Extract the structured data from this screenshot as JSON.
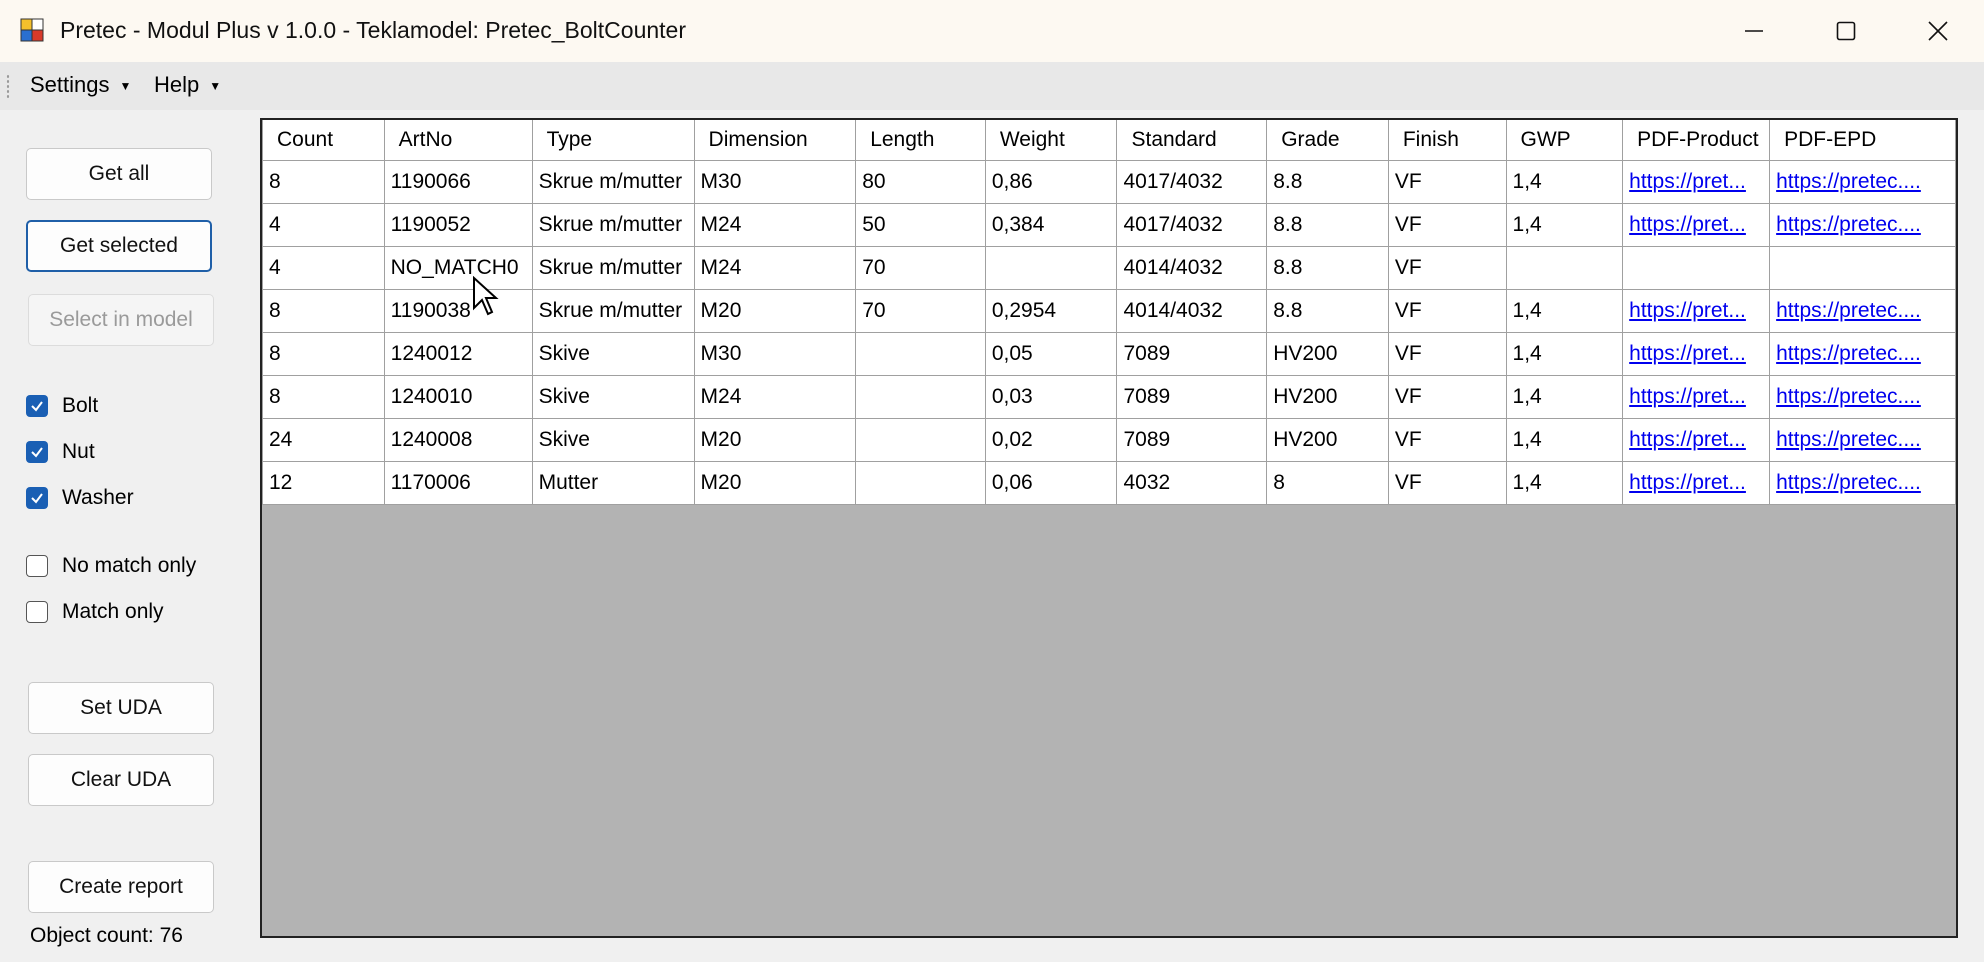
{
  "window": {
    "title": "Pretec - Modul Plus v 1.0.0 - Teklamodel: Pretec_BoltCounter"
  },
  "menu": {
    "settings_label": "Settings",
    "help_label": "Help"
  },
  "buttons": {
    "get_all": "Get all",
    "get_selected": "Get selected",
    "select_in_model": "Select in model",
    "set_uda": "Set UDA",
    "clear_uda": "Clear UDA",
    "create_report": "Create report"
  },
  "filters": {
    "bolt": {
      "label": "Bolt",
      "checked": true
    },
    "nut": {
      "label": "Nut",
      "checked": true
    },
    "washer": {
      "label": "Washer",
      "checked": true
    },
    "no_match_only": {
      "label": "No match only",
      "checked": false
    },
    "match_only": {
      "label": "Match only",
      "checked": false
    }
  },
  "status": {
    "object_count": "Object count: 76"
  },
  "table": {
    "columns": [
      "Count",
      "ArtNo",
      "Type",
      "Dimension",
      "Length",
      "Weight",
      "Standard",
      "Grade",
      "Finish",
      "GWP",
      "PDF-Product",
      "PDF-EPD"
    ],
    "rows": [
      [
        "8",
        "1190066",
        "Skrue m/mutter",
        "M30",
        "80",
        "0,86",
        "4017/4032",
        "8.8",
        "VF",
        "1,4",
        "https://pret...",
        "https://pretec...."
      ],
      [
        "4",
        "1190052",
        "Skrue m/mutter",
        "M24",
        "50",
        "0,384",
        "4017/4032",
        "8.8",
        "VF",
        "1,4",
        "https://pret...",
        "https://pretec...."
      ],
      [
        "4",
        "NO_MATCH0",
        "Skrue m/mutter",
        "M24",
        "70",
        "",
        "4014/4032",
        "8.8",
        "VF",
        "",
        "",
        ""
      ],
      [
        "8",
        "1190038",
        "Skrue m/mutter",
        "M20",
        "70",
        "0,2954",
        "4014/4032",
        "8.8",
        "VF",
        "1,4",
        "https://pret...",
        "https://pretec...."
      ],
      [
        "8",
        "1240012",
        "Skive",
        "M30",
        "",
        "0,05",
        "7089",
        "HV200",
        "VF",
        "1,4",
        "https://pret...",
        "https://pretec...."
      ],
      [
        "8",
        "1240010",
        "Skive",
        "M24",
        "",
        "0,03",
        "7089",
        "HV200",
        "VF",
        "1,4",
        "https://pret...",
        "https://pretec...."
      ],
      [
        "24",
        "1240008",
        "Skive",
        "M20",
        "",
        "0,02",
        "7089",
        "HV200",
        "VF",
        "1,4",
        "https://pret...",
        "https://pretec...."
      ],
      [
        "12",
        "1170006",
        "Mutter",
        "M20",
        "",
        "0,06",
        "4032",
        "8",
        "VF",
        "1,4",
        "https://pret...",
        "https://pretec...."
      ]
    ]
  },
  "colors": {
    "accent": "#1a5fb4",
    "link": "#0000ee",
    "grid_background": "#b3b3b3"
  }
}
